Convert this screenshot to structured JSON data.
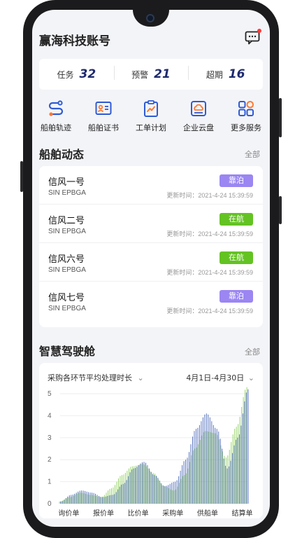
{
  "header": {
    "title": "赢海科技账号"
  },
  "stats": [
    {
      "label": "任务",
      "value": "32"
    },
    {
      "label": "预警",
      "value": "21"
    },
    {
      "label": "超期",
      "value": "16"
    }
  ],
  "shortcuts": [
    {
      "label": "船舶轨迹",
      "icon": "route-icon"
    },
    {
      "label": "船舶证书",
      "icon": "certificate-icon"
    },
    {
      "label": "工单计划",
      "icon": "clipboard-chart-icon"
    },
    {
      "label": "企业云盘",
      "icon": "cloud-drive-icon"
    },
    {
      "label": "更多服务",
      "icon": "grid-more-icon"
    }
  ],
  "ship_section": {
    "title": "船舶动态",
    "more": "全部"
  },
  "ships": [
    {
      "name": "信风一号",
      "code": "SIN EPBGA",
      "status": "靠泊",
      "status_type": "moored",
      "time": "更新时间：2021-4-24 15:39:59"
    },
    {
      "name": "信风二号",
      "code": "SIN EPBGA",
      "status": "在航",
      "status_type": "sailing",
      "time": "更新时间：2021-4-24 15:39:59"
    },
    {
      "name": "信风六号",
      "code": "SIN EPBGA",
      "status": "在航",
      "status_type": "sailing",
      "time": "更新时间：2021-4-24 15:39:59"
    },
    {
      "name": "信风七号",
      "code": "SIN EPBGA",
      "status": "靠泊",
      "status_type": "moored",
      "time": "更新时间：2021-4-24 15:39:59"
    }
  ],
  "cockpit_section": {
    "title": "智慧驾驶舱",
    "more": "全部"
  },
  "chart_header": {
    "selector": "采购各环节平均处理时长",
    "range": "4月1日-4月30日"
  },
  "colors": {
    "accent": "#2f5bd3",
    "moored": "#9b86f2",
    "sailing": "#63c322",
    "series_green": "#8ed15a",
    "series_blue": "#4a68b8"
  },
  "chart_data": {
    "type": "bar",
    "categories": [
      "询价单",
      "报价单",
      "比价单",
      "采购单",
      "供船单",
      "结算单"
    ],
    "ylim": [
      0,
      5
    ],
    "yticks": [
      0,
      1,
      2,
      3,
      4,
      5
    ],
    "series": [
      {
        "values_x": [
          0.0,
          0.3,
          0.6,
          0.9,
          1.2,
          1.5,
          1.8,
          2.1,
          2.4,
          2.7,
          3.0,
          3.3,
          3.6,
          3.9,
          4.2,
          4.5,
          4.8,
          5.1,
          5.4
        ],
        "values": [
          0.1,
          0.3,
          0.5,
          0.4,
          0.3,
          0.7,
          1.3,
          1.7,
          1.8,
          1.4,
          0.8,
          0.6,
          1.3,
          2.5,
          3.3,
          3.2,
          2.1,
          3.5,
          5.3
        ]
      },
      {
        "values_x": [
          0.0,
          0.3,
          0.6,
          0.9,
          1.2,
          1.5,
          1.8,
          2.1,
          2.4,
          2.7,
          3.0,
          3.3,
          3.6,
          3.9,
          4.2,
          4.5,
          4.8,
          5.1,
          5.4
        ],
        "values": [
          0.1,
          0.4,
          0.6,
          0.5,
          0.3,
          0.4,
          0.9,
          1.6,
          1.9,
          1.3,
          0.8,
          1.0,
          2.0,
          3.4,
          4.1,
          3.4,
          1.6,
          3.0,
          5.2
        ]
      }
    ]
  }
}
